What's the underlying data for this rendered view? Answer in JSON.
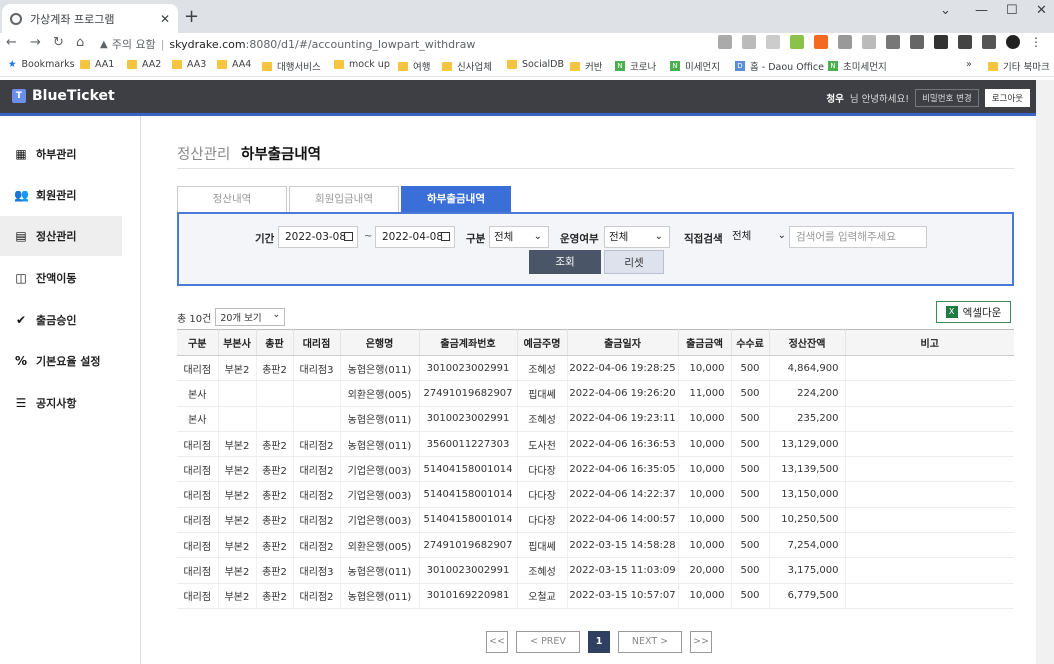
{
  "browser": {
    "tab_title": "가상계좌 프로그램",
    "url_warning": "주의 요함",
    "url_host": "skydrake.com",
    "url_path": ":8080/d1/#/accounting_lowpart_withdraw",
    "bookmarks": [
      "Bookmarks",
      "AA1",
      "AA2",
      "AA3",
      "AA4",
      "대행서비스",
      "mock up",
      "여행",
      "신사업체",
      "SocialDB",
      "커반",
      "코로나",
      "미세먼지",
      "홈 - Daou Office",
      "초미세먼지",
      "»",
      "기타 북마크"
    ]
  },
  "header": {
    "brand": "BlueTicket",
    "user": "청우",
    "greeting": "님 안녕하세요!",
    "change_pw": "비밀번호 변경",
    "logout": "로그아웃"
  },
  "sidebar": {
    "items": [
      {
        "label": "하부관리",
        "icon": "org-icon"
      },
      {
        "label": "회원관리",
        "icon": "users-icon"
      },
      {
        "label": "정산관리",
        "icon": "calculator-icon"
      },
      {
        "label": "잔액이동",
        "icon": "transfer-icon"
      },
      {
        "label": "출금승인",
        "icon": "check-badge-icon"
      },
      {
        "label": "기본요율 설정",
        "icon": "percent-icon"
      },
      {
        "label": "공지사항",
        "icon": "list-icon"
      }
    ]
  },
  "page": {
    "crumb": "정산관리",
    "title": "하부출금내역",
    "tabs": [
      "정산내역",
      "회원입금내역",
      "하부출금내역"
    ]
  },
  "search": {
    "period_label": "기간",
    "date_from": "2022-03-08",
    "date_to": "2022-04-08",
    "tilde": "~",
    "type_label": "구분",
    "type_value": "전체",
    "status_label": "운영여부",
    "status_value": "전체",
    "direct_label": "직접검색",
    "direct_value": "전체",
    "keyword_placeholder": "검색어를 입력해주세요",
    "search_btn": "조회",
    "reset_btn": "리셋"
  },
  "list": {
    "count_text": "총 10건",
    "page_size": "20개 보기",
    "excel_btn": "엑셀다운",
    "columns": [
      "구분",
      "부본사",
      "총판",
      "대리점",
      "은행명",
      "출금계좌번호",
      "예금주명",
      "출금일자",
      "출금금액",
      "수수료",
      "정산잔액",
      "비고"
    ],
    "rows": [
      [
        "대리점",
        "부본2",
        "총판2",
        "대리점3",
        "농협은행(011)",
        "3010023002991",
        "조혜성",
        "2022-04-06 19:28:25",
        "10,000",
        "500",
        "4,864,900",
        ""
      ],
      [
        "본사",
        "",
        "",
        "",
        "외환은행(005)",
        "27491019682907",
        "핍대쎄",
        "2022-04-06 19:26:20",
        "11,000",
        "500",
        "224,200",
        ""
      ],
      [
        "본사",
        "",
        "",
        "",
        "농협은행(011)",
        "3010023002991",
        "조혜성",
        "2022-04-06 19:23:11",
        "10,000",
        "500",
        "235,200",
        ""
      ],
      [
        "대리점",
        "부본2",
        "총판2",
        "대리점2",
        "농협은행(011)",
        "3560011227303",
        "도사천",
        "2022-04-06 16:36:53",
        "10,000",
        "500",
        "13,129,000",
        ""
      ],
      [
        "대리점",
        "부본2",
        "총판2",
        "대리점2",
        "기업은행(003)",
        "51404158001014",
        "다다장",
        "2022-04-06 16:35:05",
        "10,000",
        "500",
        "13,139,500",
        ""
      ],
      [
        "대리점",
        "부본2",
        "총판2",
        "대리점2",
        "기업은행(003)",
        "51404158001014",
        "다다장",
        "2022-04-06 14:22:37",
        "10,000",
        "500",
        "13,150,000",
        ""
      ],
      [
        "대리점",
        "부본2",
        "총판2",
        "대리점2",
        "기업은행(003)",
        "51404158001014",
        "다다장",
        "2022-04-06 14:00:57",
        "10,000",
        "500",
        "10,250,500",
        ""
      ],
      [
        "대리점",
        "부본2",
        "총판2",
        "대리점2",
        "외환은행(005)",
        "27491019682907",
        "핍대쎄",
        "2022-03-15 14:58:28",
        "10,000",
        "500",
        "7,254,000",
        ""
      ],
      [
        "대리점",
        "부본2",
        "총판2",
        "대리점3",
        "농협은행(011)",
        "3010023002991",
        "조혜성",
        "2022-03-15 11:03:09",
        "20,000",
        "500",
        "3,175,000",
        ""
      ],
      [
        "대리점",
        "부본2",
        "총판2",
        "대리점2",
        "농협은행(011)",
        "3010169220981",
        "오철교",
        "2022-03-15 10:57:07",
        "10,000",
        "500",
        "6,779,500",
        ""
      ]
    ]
  },
  "pager": {
    "first": "<<",
    "prev": "< PREV",
    "current": "1",
    "next": "NEXT >",
    "last": ">>"
  }
}
